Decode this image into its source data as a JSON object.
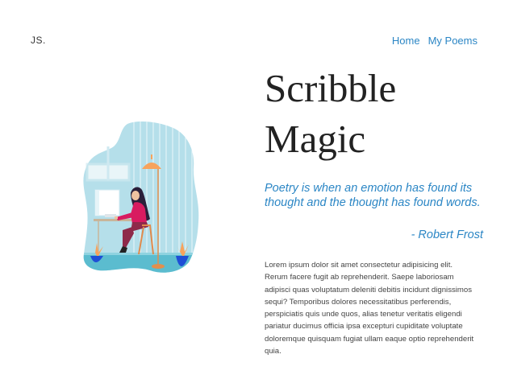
{
  "header": {
    "logo": "JS.",
    "nav": [
      {
        "label": "Home"
      },
      {
        "label": "My Poems"
      }
    ]
  },
  "hero": {
    "title_line1": "Scribble",
    "title_line2": "Magic",
    "quote": "Poetry is when an emotion has found its thought and the thought has found words.",
    "author": "- Robert Frost",
    "body": "Lorem ipsum dolor sit amet consectetur adipisicing elit. Rerum facere fugit ab reprehenderit. Saepe laboriosam adipisci quas voluptatum deleniti debitis incidunt dignissimos sequi? Temporibus dolores necessitatibus perferendis, perspiciatis quis unde quos, alias tenetur veritatis eligendi pariatur ducimus officia ipsa excepturi cupiditate voluptate doloremque quisquam fugiat ullam eaque optio reprehenderit quia."
  },
  "colors": {
    "accent": "#2b86c5",
    "illustration_bg": "#b5dfea",
    "shirt": "#d81b60",
    "lamp": "#f7a35c"
  },
  "illustration": {
    "name": "woman-working-at-desk-illustration"
  }
}
